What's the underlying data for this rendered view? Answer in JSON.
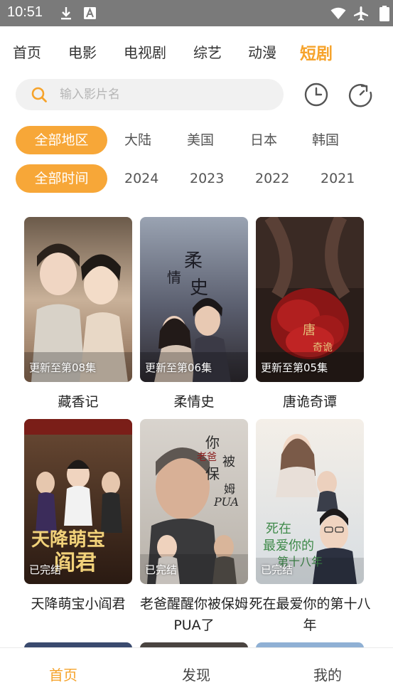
{
  "status_bar": {
    "time": "10:51",
    "icons": [
      "download-icon",
      "a-icon",
      "wifi-icon",
      "airplane-icon",
      "battery-icon"
    ]
  },
  "categories": [
    {
      "label": "首页",
      "active": false
    },
    {
      "label": "电影",
      "active": false
    },
    {
      "label": "电视剧",
      "active": false
    },
    {
      "label": "综艺",
      "active": false
    },
    {
      "label": "动漫",
      "active": false
    },
    {
      "label": "短剧",
      "active": true
    }
  ],
  "search": {
    "placeholder": "输入影片名",
    "value": ""
  },
  "actions": [
    "history-icon",
    "refresh-icon"
  ],
  "filters": {
    "region": [
      "全部地区",
      "大陆",
      "美国",
      "日本",
      "韩国"
    ],
    "year": [
      "全部时间",
      "2024",
      "2023",
      "2022",
      "2021"
    ],
    "region_selected": "全部地区",
    "year_selected": "全部时间"
  },
  "items": [
    {
      "title": "藏香记",
      "badge": "更新至第08集"
    },
    {
      "title": "柔情史",
      "badge": "更新至第06集"
    },
    {
      "title": "唐诡奇谭",
      "badge": "更新至第05集"
    },
    {
      "title": "天降萌宝小阎君",
      "badge": "已完结"
    },
    {
      "title": "老爸醒醒你被保姆PUA了",
      "badge": "已完结"
    },
    {
      "title": "死在最爱你的第十八年",
      "badge": "已完结"
    }
  ],
  "bottom_nav": [
    {
      "label": "首页",
      "active": true
    },
    {
      "label": "发现",
      "active": false
    },
    {
      "label": "我的",
      "active": false
    }
  ],
  "colors": {
    "accent": "#f6a32b",
    "status_bar": "#7a7a7a",
    "search_bg": "#f1f1f1"
  }
}
